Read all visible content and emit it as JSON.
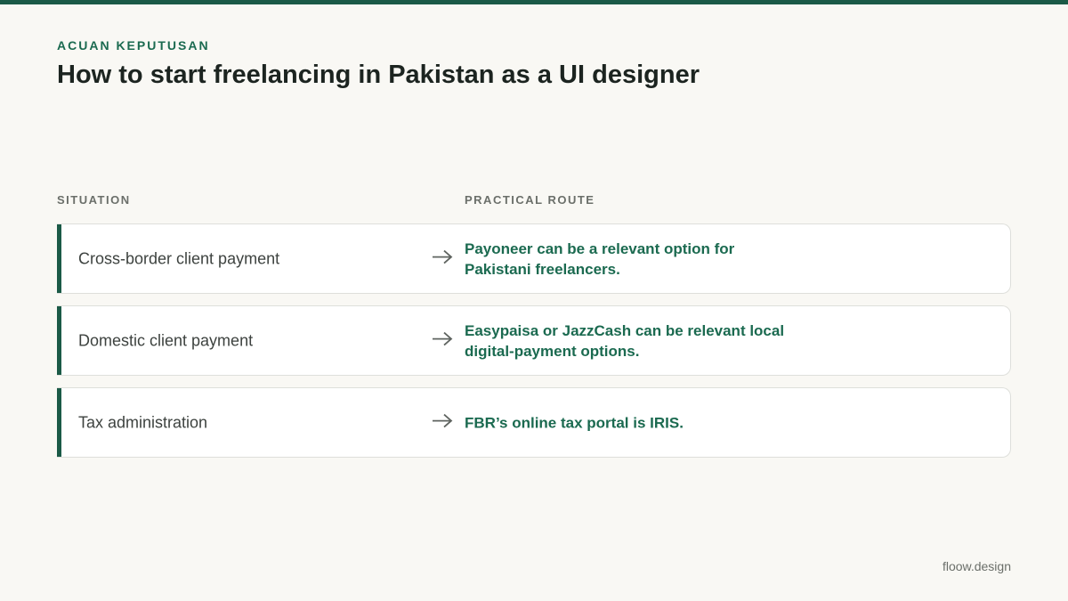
{
  "eyebrow": "ACUAN KEPUTUSAN",
  "title": "How to start freelancing in Pakistan as a UI designer",
  "columns": {
    "situation": "SITUATION",
    "route": "PRACTICAL ROUTE"
  },
  "rows": [
    {
      "situation": "Cross-border client payment",
      "route": "Payoneer can be a relevant option for Pakistani freelancers."
    },
    {
      "situation": "Domestic client payment",
      "route": "Easypaisa or JazzCash can be relevant local digital-payment options."
    },
    {
      "situation": "Tax administration",
      "route": "FBR’s online tax portal is IRIS."
    }
  ],
  "footer": {
    "brand": "floow.design"
  },
  "colors": {
    "accent": "#1b5a47",
    "route_text": "#1b6a50",
    "background": "#f9f8f4"
  },
  "icons": {
    "row_arrow": "arrow-right-icon"
  }
}
